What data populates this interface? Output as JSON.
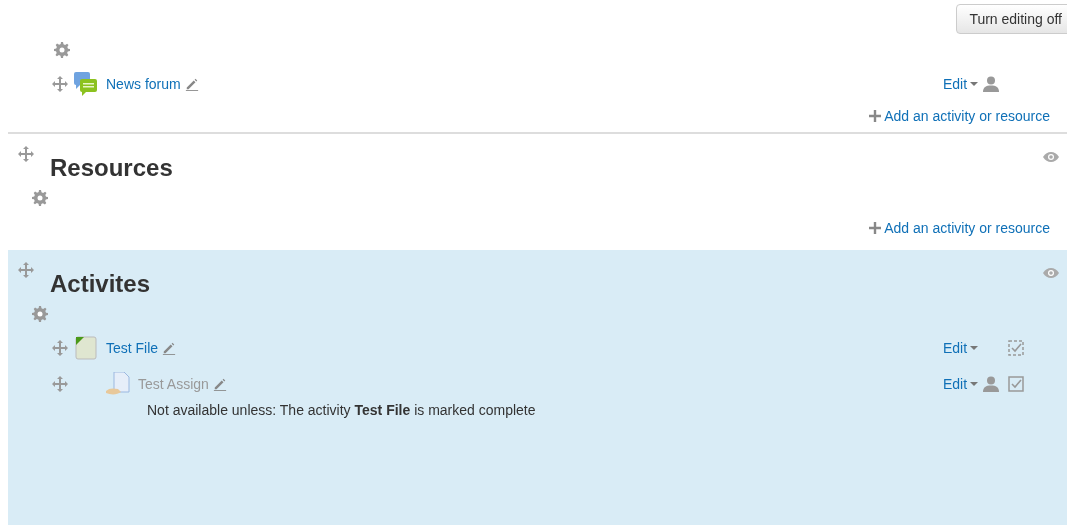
{
  "edit_button": "Turn editing off",
  "sections": [
    {
      "highlighted": false,
      "activities": [
        {
          "name": "News forum",
          "kind": "forum",
          "dimmed": false,
          "indented": false,
          "edit": "Edit",
          "group_mode": true,
          "auto_completion": false,
          "manual_completion": false
        }
      ],
      "add_link": "Add an activity or resource"
    },
    {
      "title": "Resources",
      "highlighted": false,
      "visible_toggle": true,
      "move_handle": true,
      "add_link": "Add an activity or resource"
    },
    {
      "title": "Activites",
      "highlighted": true,
      "visible_toggle": true,
      "move_handle": true,
      "activities": [
        {
          "name": "Test File",
          "kind": "file",
          "dimmed": false,
          "indented": false,
          "edit": "Edit",
          "group_mode": false,
          "auto_completion": true,
          "manual_completion": false
        },
        {
          "name": "Test Assign",
          "kind": "assign",
          "dimmed": true,
          "indented": true,
          "edit": "Edit",
          "group_mode": true,
          "auto_completion": false,
          "manual_completion": true,
          "restriction": "Not available unless: The activity **Test File** is marked complete"
        }
      ]
    }
  ]
}
